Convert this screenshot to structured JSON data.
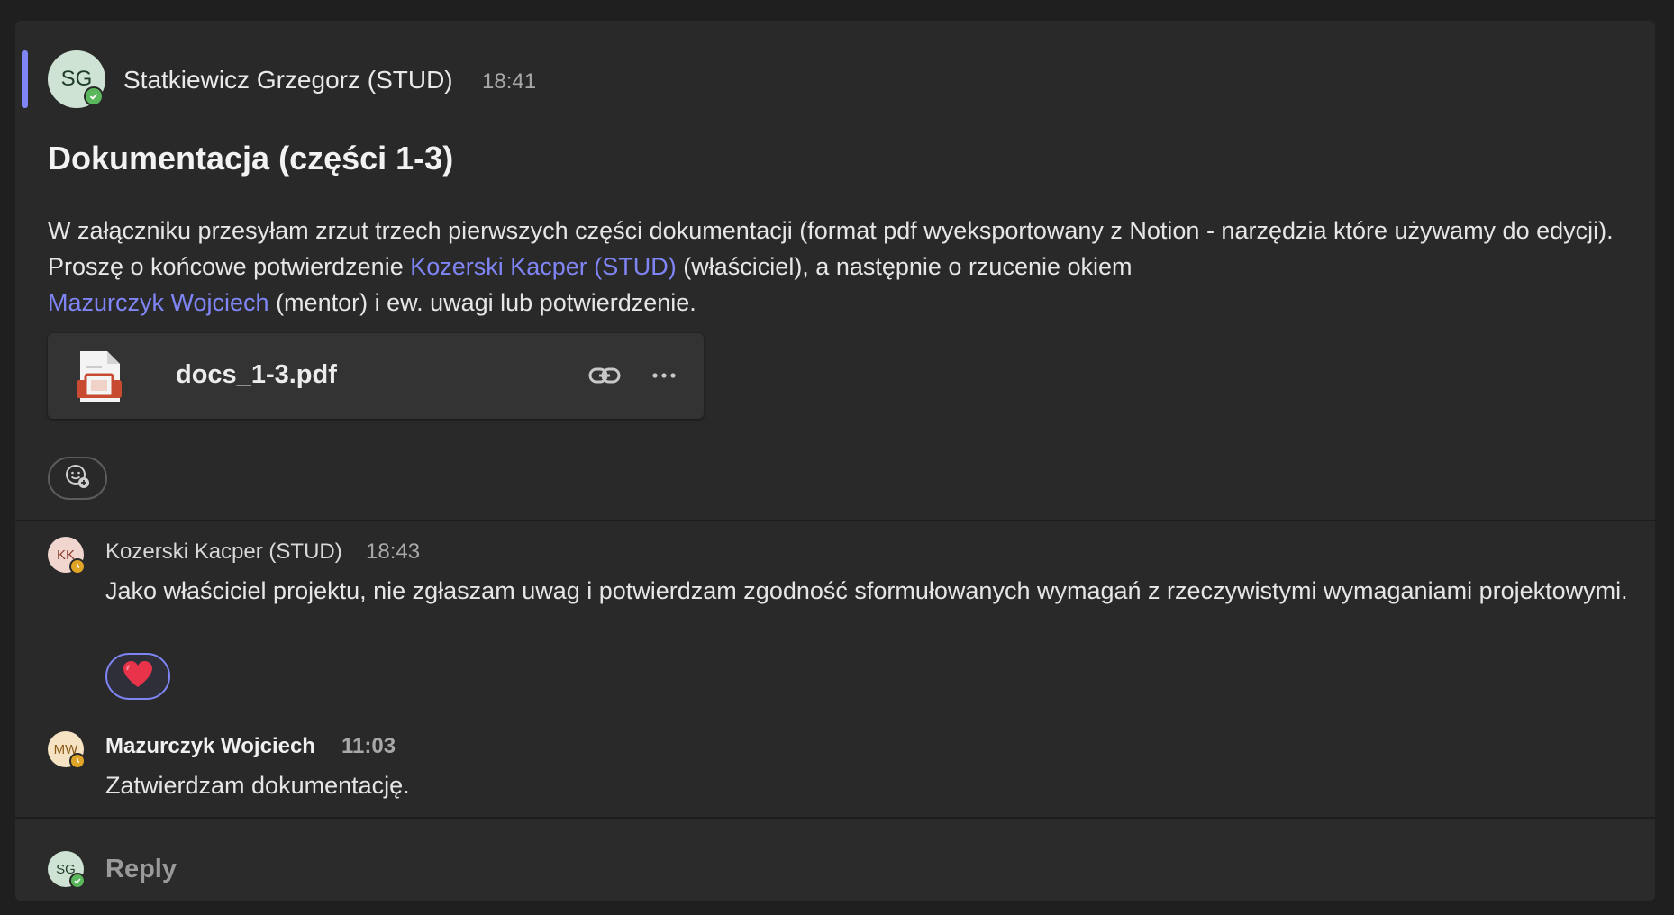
{
  "post": {
    "avatar_initials": "SG",
    "author": "Statkiewicz Grzegorz (STUD)",
    "time": "18:41",
    "title": "Dokumentacja (części 1-3)",
    "body_part1": "W załączniku przesyłam zrzut trzech pierwszych części dokumentacji (format pdf wyeksportowany z Notion - narzędzia które używamy do edycji). Proszę o końcowe potwierdzenie ",
    "mention1": "Kozerski Kacper (STUD)",
    "body_part2": " (właściciel), a następnie o rzucenie okiem ",
    "mention2": "Mazurczyk Wojciech",
    "body_part3": " (mentor) i ew. uwagi lub potwierdzenie.",
    "attachment": {
      "name": "docs_1-3.pdf",
      "icon": "pdf-file-icon",
      "link_icon": "link-icon",
      "more_icon": "more-options-icon"
    },
    "add_reaction_icon": "add-reaction-icon",
    "accent_color": "#7f85f5"
  },
  "replies": [
    {
      "avatar_initials": "KK",
      "author": "Kozerski Kacper (STUD)",
      "time": "18:43",
      "text": "Jako właściciel projektu, nie zgłaszam uwag i potwierdzam zgodność sformułowanych wymagań z rzeczywistymi wymaganiami projektowymi.",
      "reaction": "heart-icon"
    },
    {
      "avatar_initials": "MW",
      "author": "Mazurczyk Wojciech",
      "time": "11:03",
      "text": "Zatwierdzam dokumentację."
    }
  ],
  "reply_box": {
    "avatar_initials": "SG",
    "placeholder": "Reply"
  }
}
